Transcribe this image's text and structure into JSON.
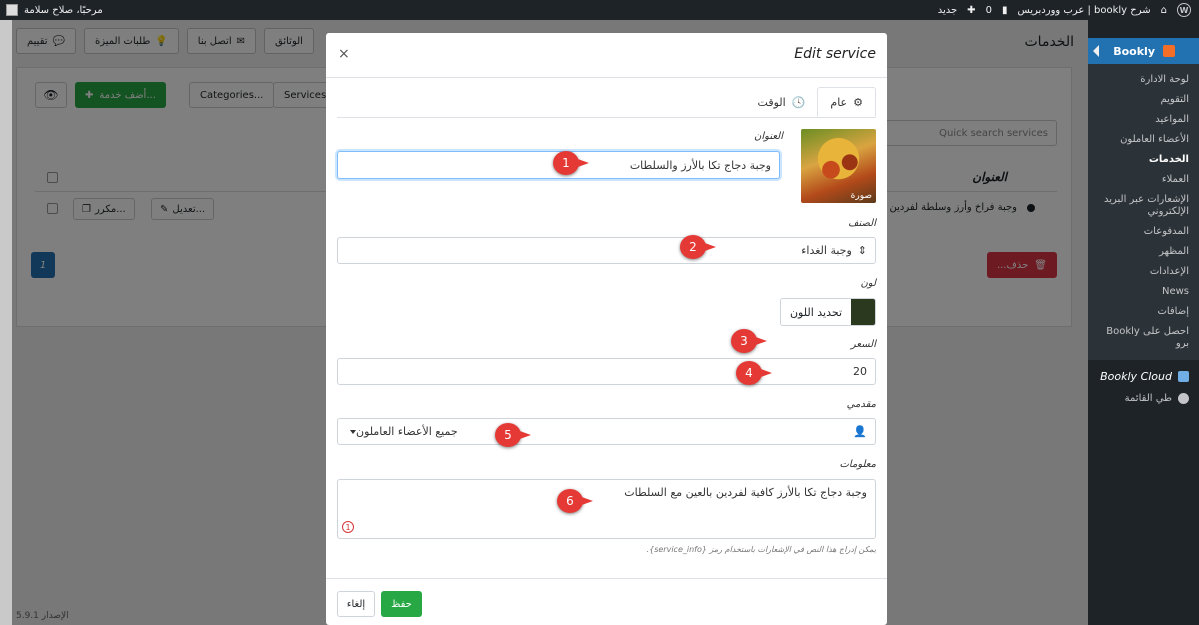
{
  "adminbar": {
    "site_title": "شرح bookly | عرب ووردبريس",
    "comments_count": "0",
    "new_label": "جديد",
    "greeting": "مرحبًا، صلاح سلامة"
  },
  "sidebar": {
    "plugin_title": "Bookly",
    "items": [
      {
        "label": "لوحة الادارة"
      },
      {
        "label": "التقويم"
      },
      {
        "label": "المواعيد"
      },
      {
        "label": "الأعضاء العاملون"
      },
      {
        "label": "الخدمات"
      },
      {
        "label": "العملاء"
      },
      {
        "label": "الإشعارات عبر البريد الإلكتروني"
      },
      {
        "label": "المدفوعات"
      },
      {
        "label": "المظهر"
      },
      {
        "label": "الإعدادات"
      },
      {
        "label": "News"
      },
      {
        "label": "إضافات"
      },
      {
        "label": "احصل على Bookly برو"
      }
    ],
    "cloud": "Bookly Cloud",
    "collapse": "طي القائمة"
  },
  "main": {
    "page_title": "الخدمات",
    "top_buttons": [
      "الوثائق",
      "اتصل بنا",
      "طلبات الميزة",
      "تقييم"
    ],
    "add_service": "أضف خدمة...",
    "categories": "Categories...",
    "services": "Services...",
    "search_placeholder": "Quick search services",
    "col_title": "العنوان",
    "row_name": "وجبة فراخ وأرز وسلطة لفردين",
    "edit": "تعديل...",
    "duplicate": "مكرر...",
    "delete": "حذف...",
    "page": "1",
    "version": "الإصدار 5.9.1"
  },
  "modal": {
    "title": "Edit service",
    "close": "×",
    "tabs": [
      {
        "label": "عام"
      },
      {
        "label": "الوقت"
      }
    ],
    "image_caption": "صورة",
    "fields": {
      "title_label": "العنوان",
      "title_value": "وجبة دجاج تكا بالأرز والسلطات",
      "category_label": "الصنف",
      "category_value": "وجبة الغداء",
      "color_label": "لون",
      "color_button": "تحديد اللون",
      "color_value": "#2b3a1f",
      "price_label": "السعر",
      "price_value": "20",
      "providers_label": "مقدمي",
      "providers_value": "جميع الأعضاء العاملون",
      "info_label": "معلومات",
      "info_value": "وجبة دجاج تكا بالأرز كافية لفردين بالعين مع السلطات",
      "info_hint": "يمكن إدراج هذا النص في الإشعارات باستخدام رمز {service_info}."
    },
    "warn": "1",
    "save": "حفظ",
    "cancel": "إلغاء"
  },
  "callouts": [
    "1",
    "2",
    "3",
    "4",
    "5",
    "6"
  ],
  "colors": {
    "accent_blue": "#2271b1",
    "save_green": "#28a745",
    "delete_red": "#dc3545",
    "callout_red": "#e53935"
  }
}
